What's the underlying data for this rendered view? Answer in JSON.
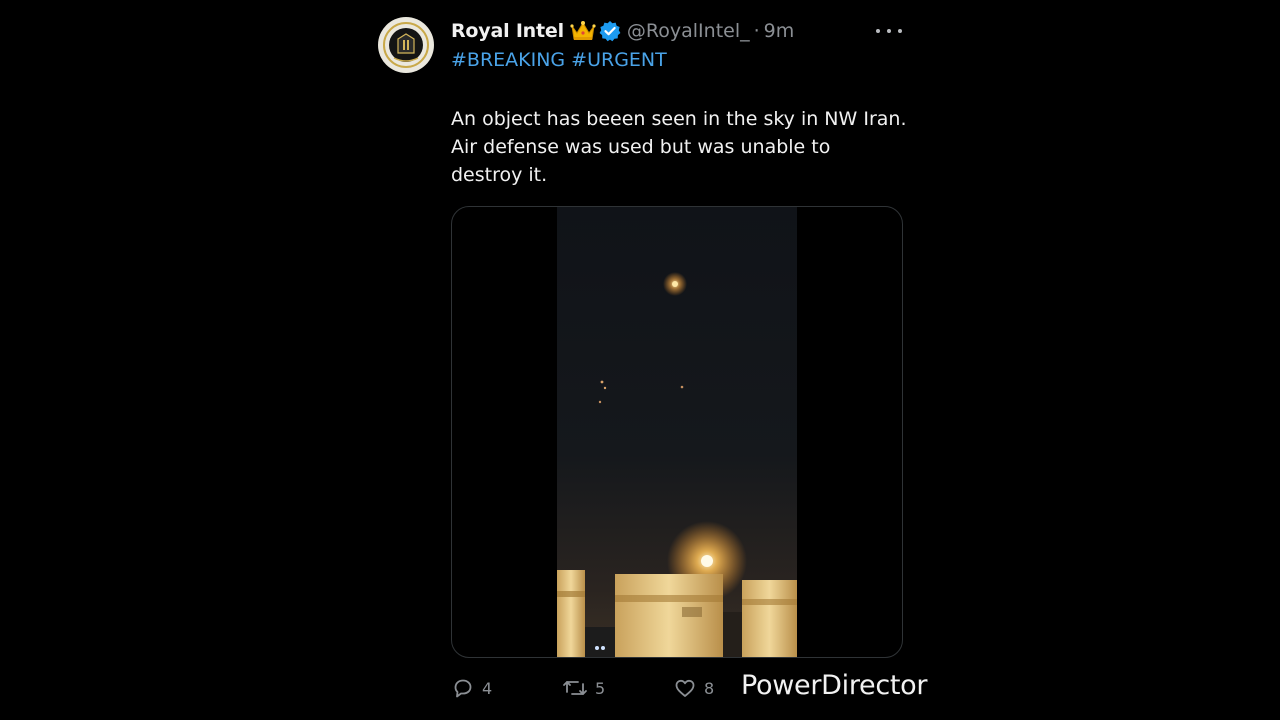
{
  "tweet": {
    "display_name": "Royal Intel",
    "handle": "@RoyalIntel_",
    "separator": "·",
    "time": "9m",
    "hashtags": [
      "#BREAKING",
      "#URGENT"
    ],
    "text_lines": [
      "An object has beeen seen in the sky in NW Iran.",
      "Air defense was used but was unable to",
      "destroy it."
    ],
    "badges": [
      "crown-icon",
      "verified-icon"
    ]
  },
  "actions": {
    "reply_count": "4",
    "retweet_count": "5",
    "like_count": "8"
  },
  "watermark": "PowerDirector",
  "colors": {
    "background": "#000000",
    "hashtag": "#4aa3e8",
    "verified": "#1d9bf0",
    "muted": "#8b8f94"
  }
}
